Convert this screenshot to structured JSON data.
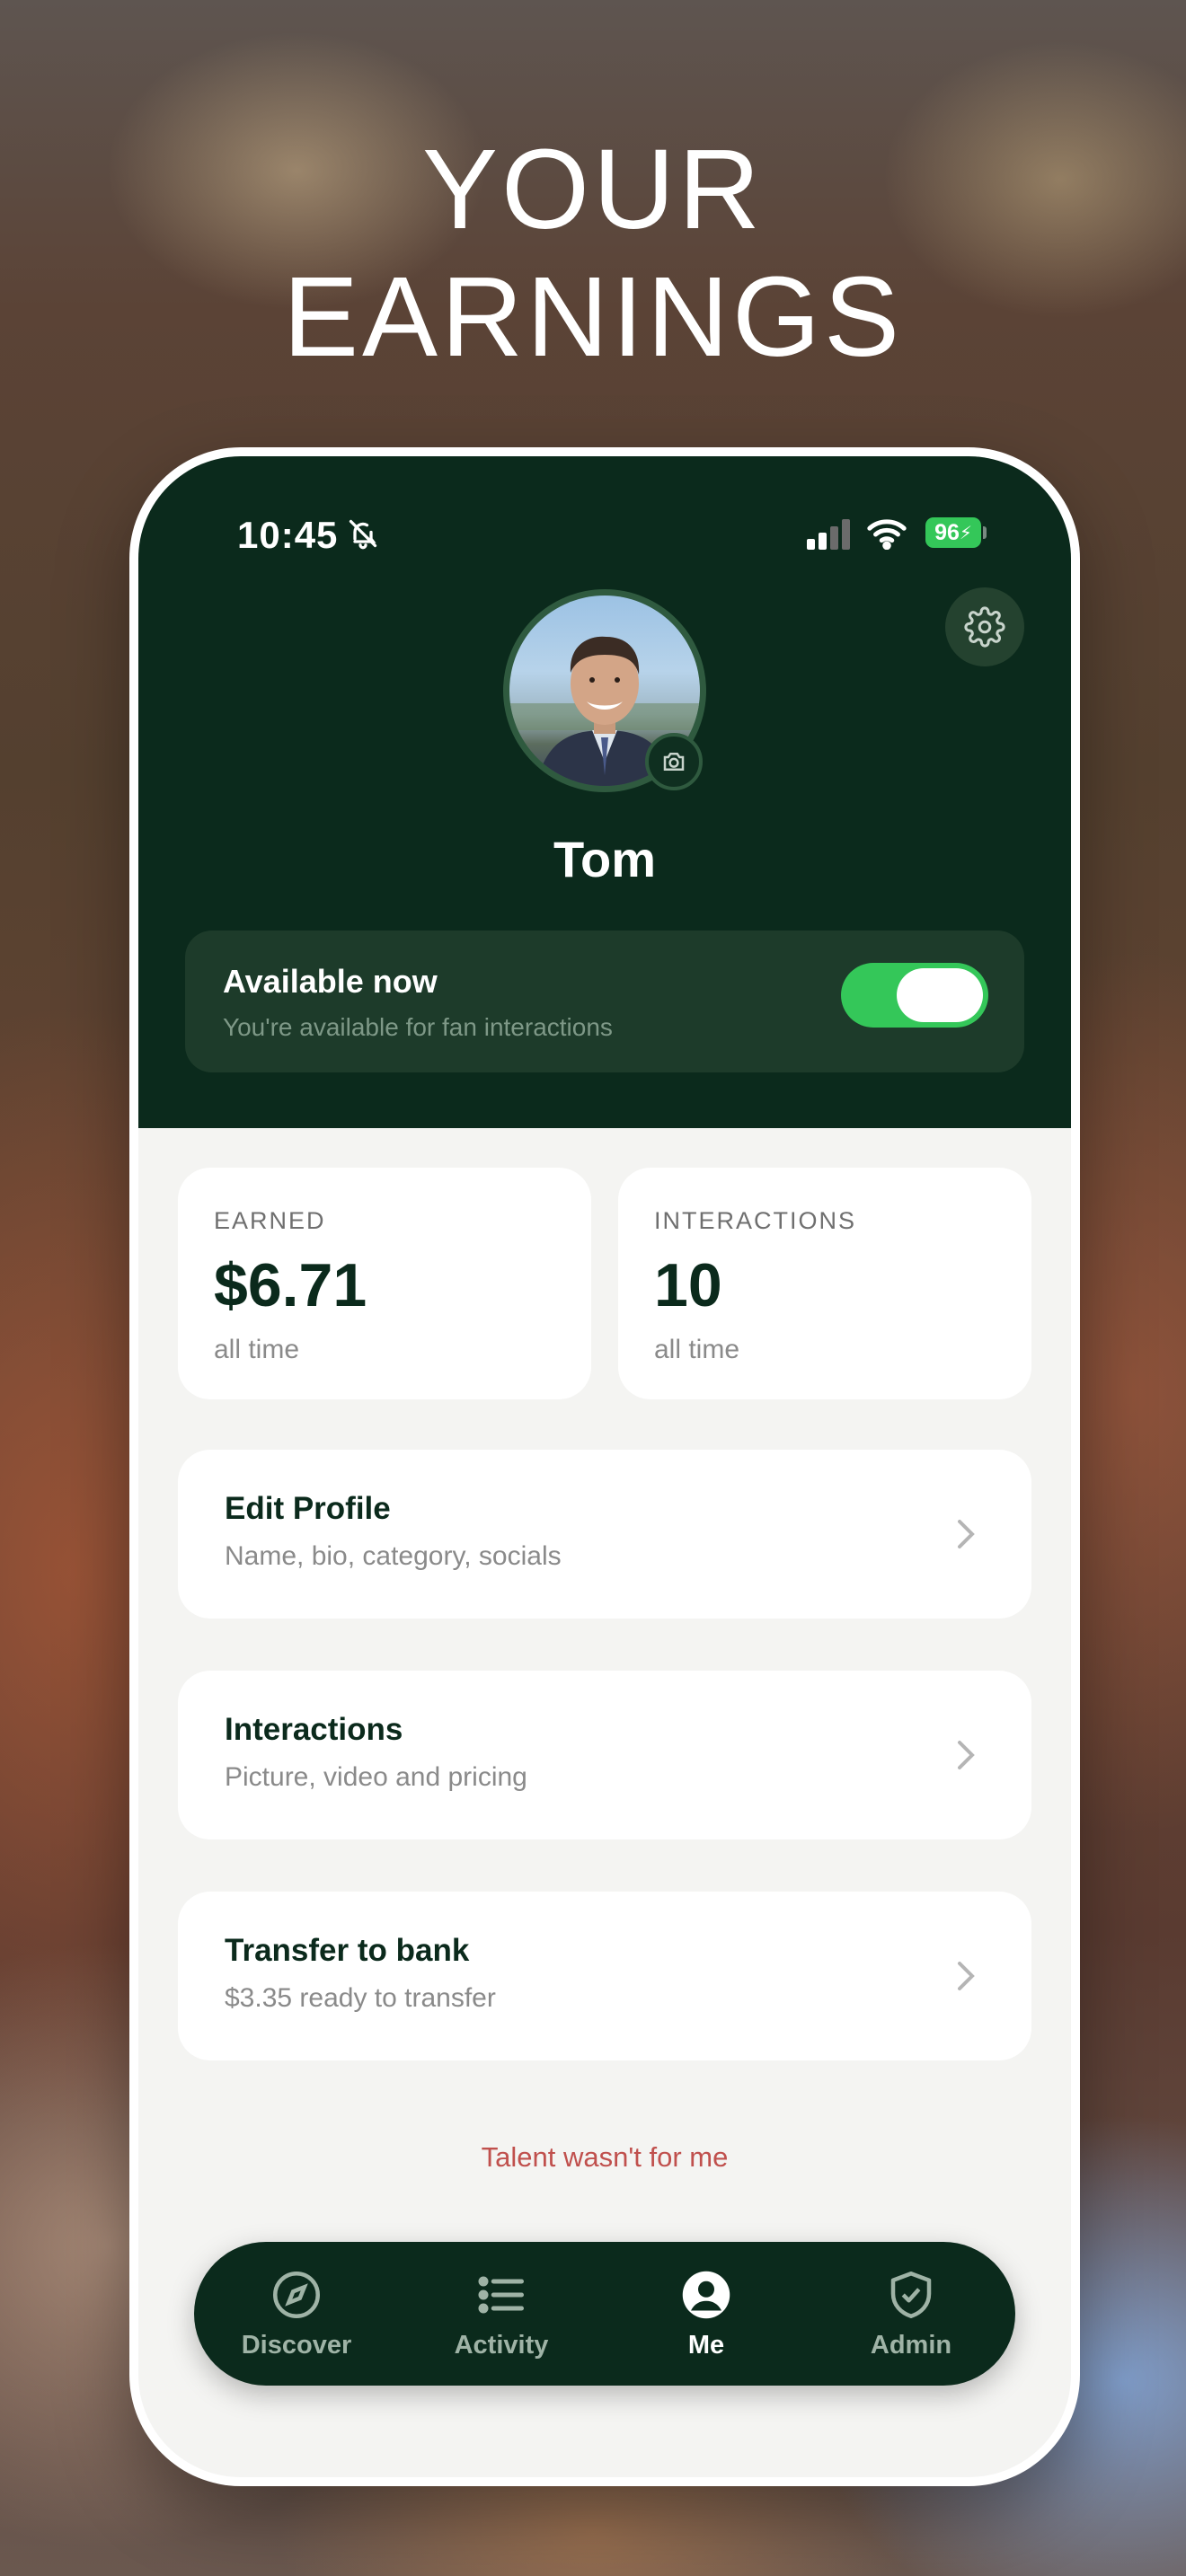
{
  "headline": {
    "line1": "YOUR",
    "line2": "EARNINGS"
  },
  "status_bar": {
    "time": "10:45",
    "battery": "96"
  },
  "profile": {
    "name": "Tom"
  },
  "availability": {
    "title": "Available now",
    "subtitle": "You're available for fan interactions",
    "enabled": true
  },
  "stats": [
    {
      "label": "EARNED",
      "value": "$6.71",
      "sub": "all time"
    },
    {
      "label": "INTERACTIONS",
      "value": "10",
      "sub": "all time"
    }
  ],
  "menu": [
    {
      "title": "Edit Profile",
      "subtitle": "Name, bio, category, socials"
    },
    {
      "title": "Interactions",
      "subtitle": "Picture, video and pricing"
    },
    {
      "title": "Transfer to bank",
      "subtitle": "$3.35 ready to transfer"
    }
  ],
  "quit_link": "Talent wasn't for me",
  "tabs": [
    {
      "label": "Discover",
      "icon": "compass-icon"
    },
    {
      "label": "Activity",
      "icon": "list-icon"
    },
    {
      "label": "Me",
      "icon": "user-circle-icon",
      "active": true
    },
    {
      "label": "Admin",
      "icon": "shield-check-icon"
    }
  ],
  "colors": {
    "brand_green": "#0b2a1c",
    "toggle_on": "#34c759",
    "quit_red": "#c0504d"
  }
}
